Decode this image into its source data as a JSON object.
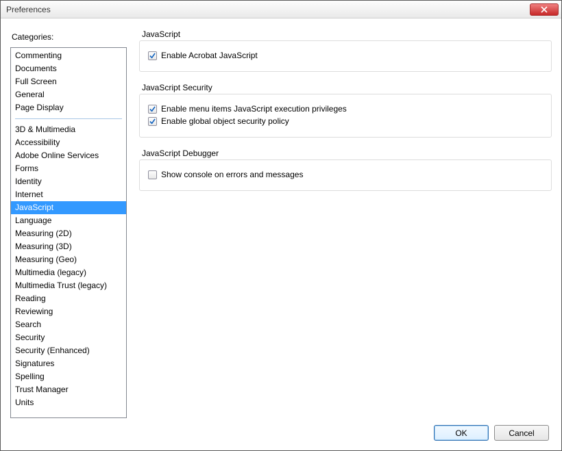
{
  "window": {
    "title": "Preferences"
  },
  "sidebar": {
    "label": "Categories:",
    "primary": [
      "Commenting",
      "Documents",
      "Full Screen",
      "General",
      "Page Display"
    ],
    "secondary": [
      "3D & Multimedia",
      "Accessibility",
      "Adobe Online Services",
      "Forms",
      "Identity",
      "Internet",
      "JavaScript",
      "Language",
      "Measuring (2D)",
      "Measuring (3D)",
      "Measuring (Geo)",
      "Multimedia (legacy)",
      "Multimedia Trust (legacy)",
      "Reading",
      "Reviewing",
      "Search",
      "Security",
      "Security (Enhanced)",
      "Signatures",
      "Spelling",
      "Trust Manager",
      "Units"
    ],
    "selected": "JavaScript"
  },
  "groups": {
    "js": {
      "title": "JavaScript",
      "opt1": {
        "label": "Enable Acrobat JavaScript",
        "checked": true
      }
    },
    "sec": {
      "title": "JavaScript Security",
      "opt1": {
        "label": "Enable menu items JavaScript execution privileges",
        "checked": true
      },
      "opt2": {
        "label": "Enable global object security policy",
        "checked": true
      }
    },
    "dbg": {
      "title": "JavaScript Debugger",
      "opt1": {
        "label": "Show console on errors and messages",
        "checked": false
      }
    }
  },
  "buttons": {
    "ok": "OK",
    "cancel": "Cancel"
  }
}
